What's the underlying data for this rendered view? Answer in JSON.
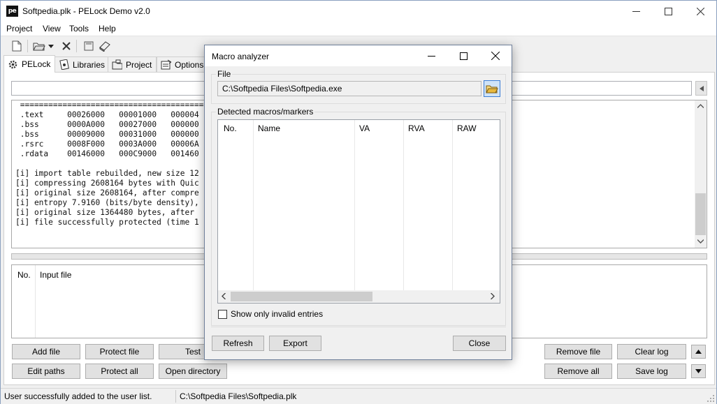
{
  "window": {
    "title": "Softpedia.plk - PELock Demo v2.0",
    "app_icon_text": "pe"
  },
  "menu": [
    "Project",
    "View",
    "Tools",
    "Help"
  ],
  "tabs": [
    {
      "label": "PELock",
      "icon": "gear-icon",
      "active": true
    },
    {
      "label": "Libraries",
      "icon": "library-icon",
      "active": false
    },
    {
      "label": "Project",
      "icon": "project-icon",
      "active": false
    },
    {
      "label": "Options",
      "icon": "options-icon",
      "active": false
    }
  ],
  "log": {
    "lines": [
      " ===========================================",
      " .text     00026000   00001000   000004",
      " .bss      0000A000   00027000   000000",
      " .bss      00009000   00031000   000000",
      " .rsrc     0008F000   0003A000   00006A",
      " .rdata    00146000   000C9000   001460",
      "",
      "[i] import table rebuilded, new size 12",
      "[i] compressing 2608164 bytes with Quic",
      "[i] original size 2608164, after compre",
      "[i] entropy 7.9160 (bits/byte density),",
      "[i] original size 1364480 bytes, after ",
      "[i] file successfully protected (time 1"
    ]
  },
  "files_table": {
    "columns": [
      "No.",
      "Input file"
    ]
  },
  "buttons": {
    "add_file": "Add file",
    "protect_file": "Protect file",
    "test": "Test",
    "edit_paths": "Edit paths",
    "protect_all": "Protect all",
    "open_directory": "Open directory",
    "remove_file": "Remove file",
    "clear_log": "Clear log",
    "remove_all": "Remove all",
    "save_log": "Save log"
  },
  "status": {
    "message": "User successfully added to the user list.",
    "project_path": "C:\\Softpedia Files\\Softpedia.plk"
  },
  "dialog": {
    "title": "Macro analyzer",
    "file_group": "File",
    "file_path": "C:\\Softpedia Files\\Softpedia.exe",
    "macros_group": "Detected macros/markers",
    "columns": [
      "No.",
      "Name",
      "VA",
      "RVA",
      "RAW"
    ],
    "invalid_only_label": "Show only invalid entries",
    "invalid_only_checked": false,
    "refresh": "Refresh",
    "export": "Export",
    "close": "Close"
  }
}
